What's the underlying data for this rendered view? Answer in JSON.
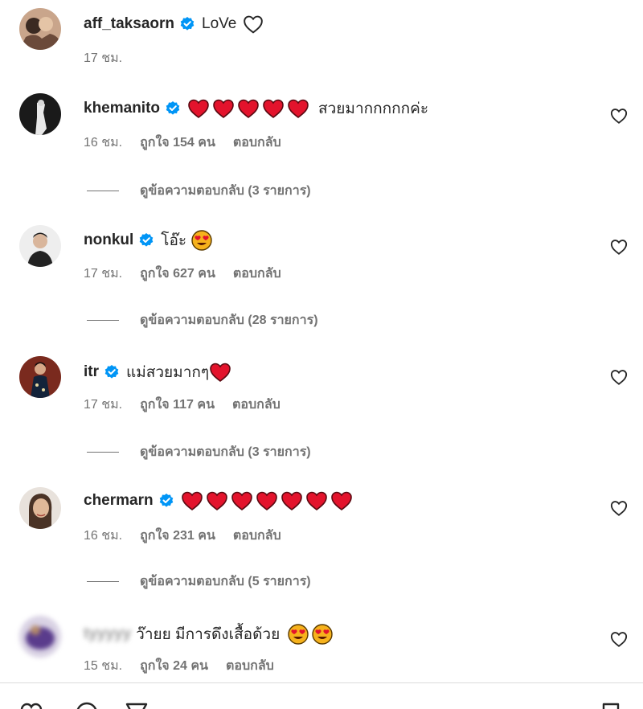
{
  "caption": {
    "username": "aff_taksaorn",
    "text": "LoVe",
    "time": "17 ชม."
  },
  "comments": [
    {
      "username": "khemanito",
      "text": "สวยมากกกกกค่ะ",
      "time": "16 ชม.",
      "likes": "ถูกใจ 154 คน",
      "reply": "ตอบกลับ",
      "view_replies": "ดูข้อความตอบกลับ (3 รายการ)",
      "hearts": 5
    },
    {
      "username": "nonkul",
      "text": "โอ๊ะ",
      "time": "17 ชม.",
      "likes": "ถูกใจ 627 คน",
      "reply": "ตอบกลับ",
      "view_replies": "ดูข้อความตอบกลับ (28 รายการ)"
    },
    {
      "username": "itr",
      "text": "แม่สวยมากๆ",
      "time": "17 ชม.",
      "likes": "ถูกใจ 117 คน",
      "reply": "ตอบกลับ",
      "view_replies": "ดูข้อความตอบกลับ (3 รายการ)"
    },
    {
      "username": "chermarn",
      "text": "",
      "time": "16 ชม.",
      "likes": "ถูกใจ 231 คน",
      "reply": "ตอบกลับ",
      "view_replies": "ดูข้อความตอบกลับ (5 รายการ)",
      "hearts": 7
    },
    {
      "username": "tyyyyy",
      "text": "ว๊ายย มีการดึงเสื้อด้วย",
      "time": "15 ชม.",
      "likes": "ถูกใจ 24 คน",
      "reply": "ตอบกลับ"
    }
  ],
  "icons": {
    "verified": "verified-badge-icon",
    "like": "heart-outline-icon",
    "heart_emoji": "red-heart-emoji",
    "face_emoji": "heart-eyes-emoji"
  },
  "colors": {
    "verified_blue": "#0095f6",
    "heart_red": "#e3132c",
    "secondary_text": "#737373",
    "primary_text": "#262626"
  }
}
